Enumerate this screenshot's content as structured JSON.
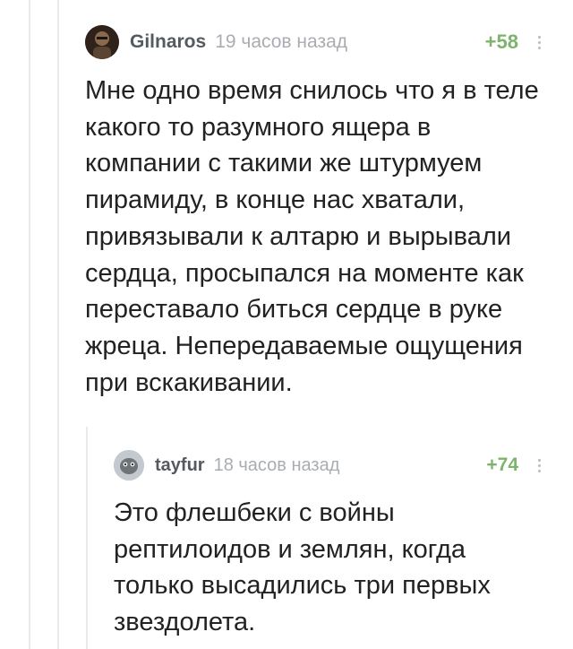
{
  "comments": [
    {
      "username": "Gilnaros",
      "time": "19 часов назад",
      "rating": "+58",
      "avatar_icon": "user-avatar-icon",
      "text": "Мне одно время снилось что я в теле какого то разумного ящера в компании с такими же штурмуем пирамиду, в конце нас хватали, привязывали к алтарю и вырывали сердца, просыпался на моменте как переставало биться сердце в руке жреца. Непередаваемые ощущения при вскакивании."
    },
    {
      "username": "tayfur",
      "time": "18 часов назад",
      "rating": "+74",
      "avatar_icon": "user-avatar-icon",
      "text": "Это флешбеки с войны рептилоидов и землян, когда только высадились три первых звездолета."
    }
  ],
  "colors": {
    "rating": "#7db46b",
    "username": "#555a60",
    "time": "#a9adb2",
    "thread_line": "#eaeaea"
  }
}
